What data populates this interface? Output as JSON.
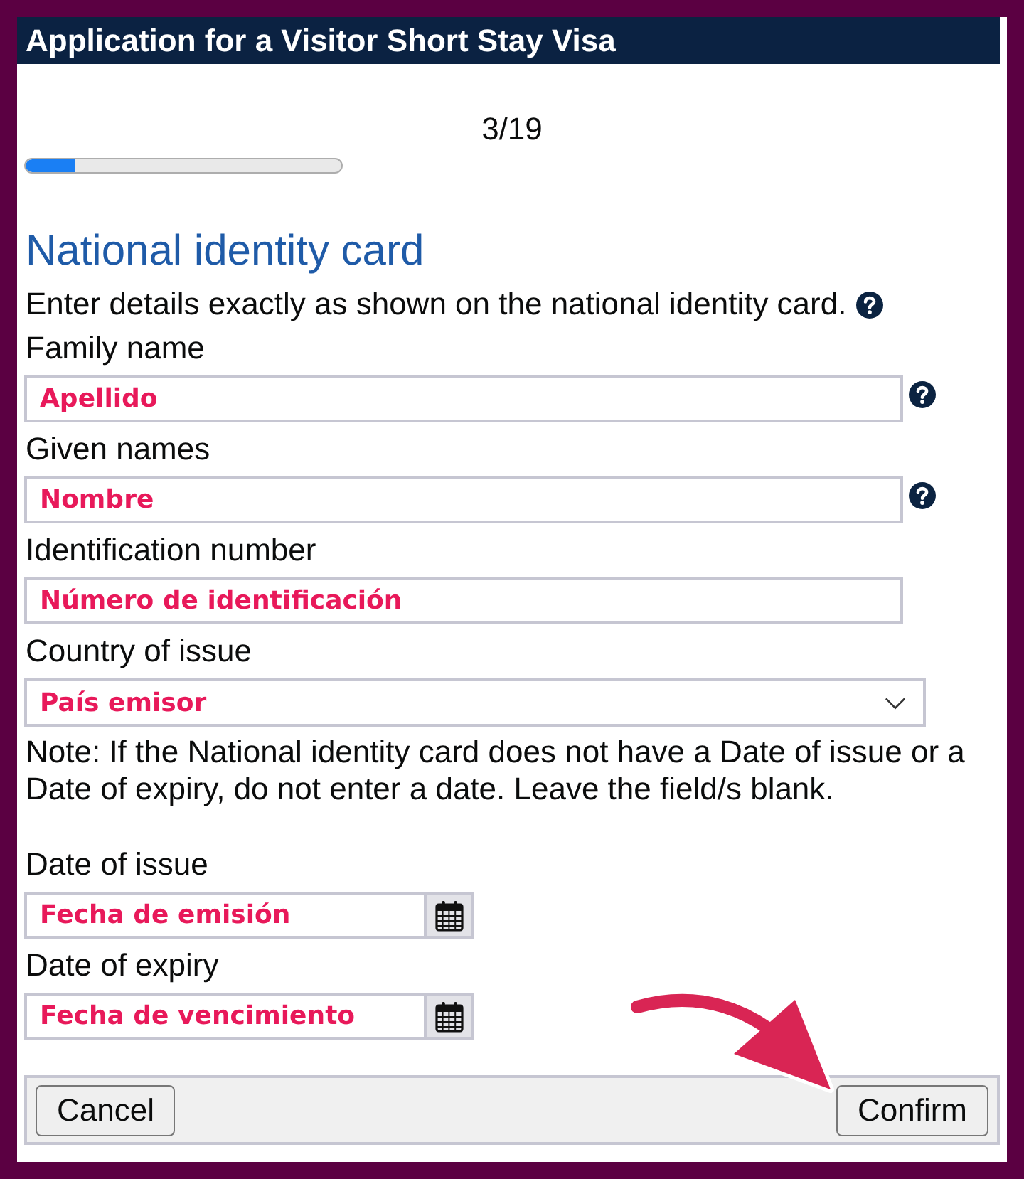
{
  "window": {
    "title": "Application for a Visitor Short Stay Visa"
  },
  "progress": {
    "step": "3/19",
    "level": 0.158
  },
  "section": {
    "heading": "National identity card",
    "intro": "Enter details exactly as shown on the national identity card.",
    "intro_help": true
  },
  "fields": [
    {
      "kind": "text",
      "label": "Family name",
      "placeholder": "Apellido",
      "help": true
    },
    {
      "kind": "text",
      "label": "Given names",
      "placeholder": "Nombre",
      "help": true
    },
    {
      "kind": "text",
      "label": "Identification number",
      "placeholder": "Número de identificación"
    },
    {
      "kind": "select",
      "label": "Country of issue",
      "placeholder": "País emisor"
    },
    {
      "kind": "note",
      "text": "Note: If the National identity card does not have a Date of issue or a Date of expiry, do not enter a date. Leave the field/s blank."
    },
    {
      "kind": "date",
      "label": "Date of issue",
      "placeholder": "Fecha de emisión"
    },
    {
      "kind": "date",
      "label": "Date of expiry",
      "placeholder": "Fecha de vencimiento"
    }
  ],
  "buttons": [
    {
      "kind": "cancel",
      "label": "Cancel"
    },
    {
      "kind": "confirm",
      "label": "Confirm"
    }
  ],
  "pointer_arrow": true
}
